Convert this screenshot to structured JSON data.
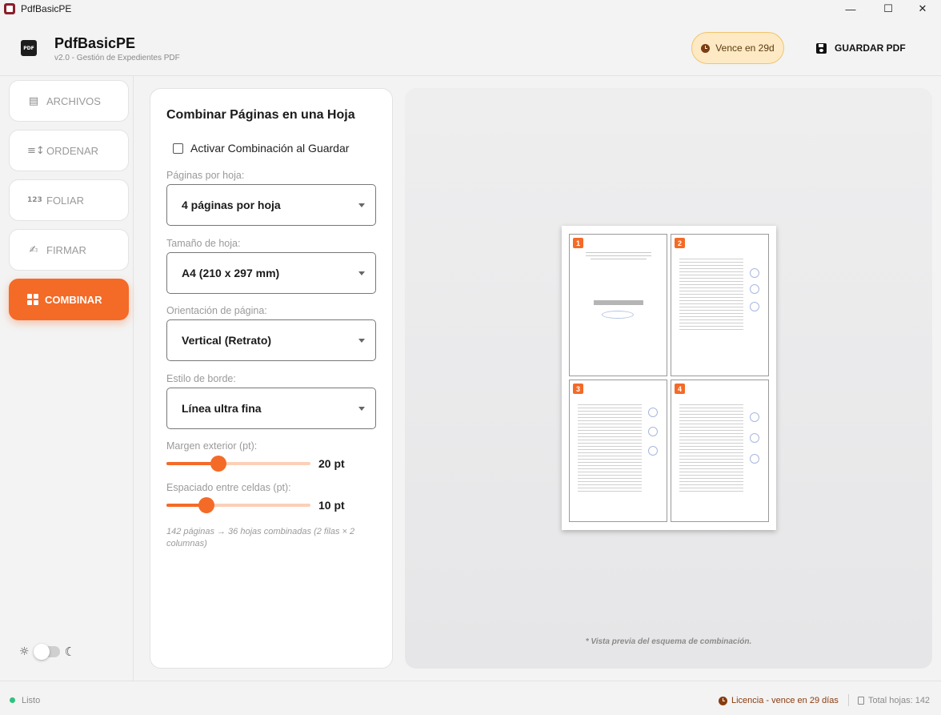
{
  "window": {
    "title": "PdfBasicPE",
    "minimize": "—",
    "maximize": "☐",
    "close": "✕"
  },
  "header": {
    "logo_text": "PDF",
    "app_name": "PdfBasicPE",
    "subtitle": "v2.0 - Gestión de Expedientes PDF",
    "expiry_badge": "Vence en 29d",
    "save_label": "GUARDAR PDF"
  },
  "sidebar": {
    "items": [
      {
        "label": "ARCHIVOS",
        "icon": "files-icon",
        "glyph": "▤"
      },
      {
        "label": "ORDENAR",
        "icon": "sort-icon",
        "glyph": "≡↕"
      },
      {
        "label": "FOLIAR",
        "icon": "numbering-icon",
        "glyph": "123"
      },
      {
        "label": "FIRMAR",
        "icon": "signature-icon",
        "glyph": "✍"
      },
      {
        "label": "COMBINAR",
        "icon": "grid-icon",
        "active": true
      }
    ],
    "theme": {
      "light_glyph": "☼",
      "dark_glyph": "☾"
    }
  },
  "panel": {
    "title": "Combinar Páginas en una Hoja",
    "enable_label": "Activar Combinación al Guardar",
    "pages_per_sheet_label": "Páginas por hoja:",
    "pages_per_sheet_value": "4 páginas por hoja",
    "sheet_size_label": "Tamaño de hoja:",
    "sheet_size_value": "A4 (210 x 297 mm)",
    "orientation_label": "Orientación de página:",
    "orientation_value": "Vertical (Retrato)",
    "border_label": "Estilo de borde:",
    "border_value": "Línea ultra fina",
    "margin_label": "Margen exterior (pt):",
    "margin": {
      "value": 20,
      "min": 0,
      "max": 55,
      "display": "20 pt"
    },
    "spacing_label": "Espaciado entre celdas (pt):",
    "spacing": {
      "value": 10,
      "min": 0,
      "max": 36,
      "display": "10 pt"
    },
    "summary": "142 páginas → 36 hojas combinadas (2 filas × 2 columnas)"
  },
  "preview": {
    "cells": [
      "1",
      "2",
      "3",
      "4"
    ],
    "note": "* Vista previa del esquema de combinación."
  },
  "status": {
    "state": "Listo",
    "license": "Licencia - vence en 29 días",
    "total": "Total hojas: 142"
  },
  "colors": {
    "accent": "#f46a27",
    "badge_bg": "#fde9c4",
    "status_ok": "#2ec27e"
  }
}
